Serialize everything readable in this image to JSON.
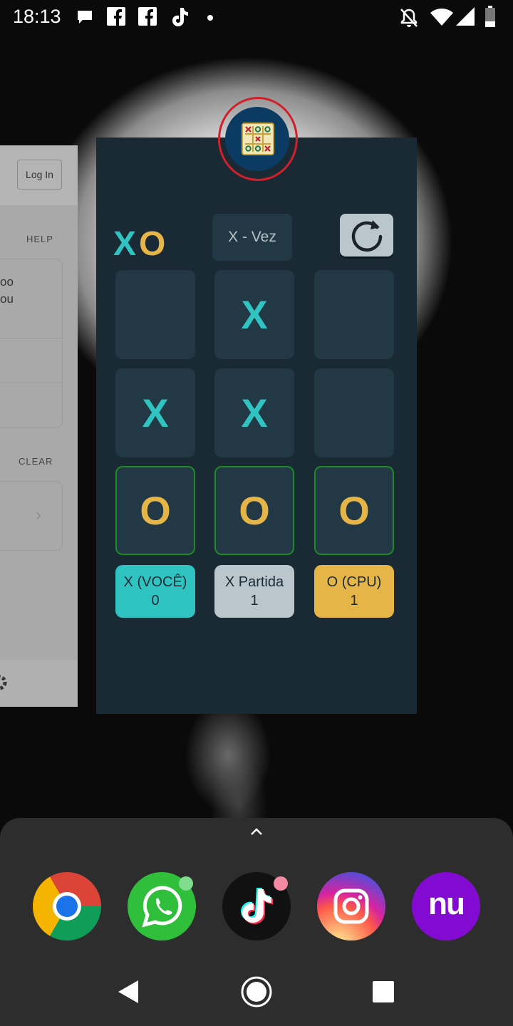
{
  "status_bar": {
    "time": "18:13",
    "notification_icons": [
      "chat-bubble-icon",
      "facebook-icon",
      "facebook-icon",
      "tiktok-icon",
      "dot-icon"
    ],
    "system_icons": [
      "bell-off-icon",
      "wifi-icon",
      "signal-icon",
      "battery-icon"
    ]
  },
  "left_card": {
    "login_label": "Log In",
    "help_label": "HELP",
    "text_line1": "oo",
    "text_line2": "ou",
    "clear_label": "CLEAR",
    "chevron": "›"
  },
  "game": {
    "logo_x": "X",
    "logo_o": "O",
    "turn_label": "X - Vez",
    "board": [
      [
        "",
        "X",
        ""
      ],
      [
        "X",
        "X",
        ""
      ],
      [
        "O",
        "O",
        "O"
      ]
    ],
    "scores": {
      "player_label": "X (VOCÊ)",
      "player_value": "0",
      "match_label": "X Partida",
      "match_value": "1",
      "cpu_label": "O (CPU)",
      "cpu_value": "1"
    },
    "colors": {
      "x": "#2fc4c2",
      "o": "#e6b548",
      "background": "#1a2a35",
      "cell": "#223844",
      "win_border": "#1f8a28"
    }
  },
  "dock": {
    "apps": [
      "chrome-icon",
      "whatsapp-icon",
      "tiktok-icon",
      "instagram-icon",
      "nubank-icon"
    ],
    "nubank_text": "nu"
  },
  "navbar": {
    "buttons": [
      "back-button",
      "home-button",
      "recents-button"
    ]
  }
}
